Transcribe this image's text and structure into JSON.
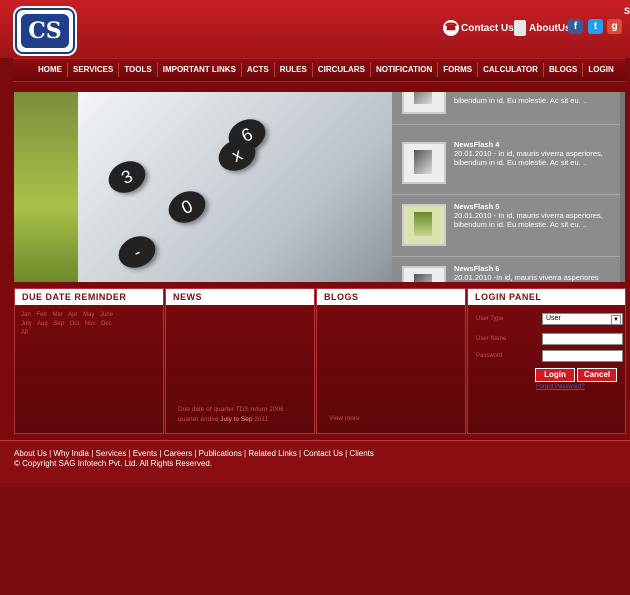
{
  "header": {
    "logo_text": "CS",
    "contact_label": "Contact Us",
    "about_label": "AboutUs",
    "social": [
      {
        "icon": "facebook-icon",
        "letter": "f",
        "color": "#3b5998"
      },
      {
        "icon": "twitter-icon",
        "letter": "t",
        "color": "#1da1f2"
      },
      {
        "icon": "google-icon",
        "letter": "g",
        "color": "#dd4b39"
      }
    ],
    "corner_glyph": "S"
  },
  "nav": [
    "HOME",
    "SERVICES",
    "TOOLS",
    "IMPORTANT LINKS",
    "ACTS",
    "RULES",
    "CIRCULARS",
    "NOTIFICATION",
    "FORMS",
    "CALCULATOR",
    "BLOGS",
    "LOGIN"
  ],
  "banner": {
    "keys": [
      "6",
      "3",
      "x",
      "0",
      "-"
    ]
  },
  "newsflash": [
    {
      "title": "",
      "text": "bibendum in id. Eu molestie. Ac sit eu. .."
    },
    {
      "title": "NewsFlash 4",
      "text": "20.01.2010 - In id, mauris viverra asperiores, bibendum in id. Eu molestie. Ac sit eu. .."
    },
    {
      "title": "NewsFlash 5",
      "text": "20.01.2010 - In id, mauris viverra asperiores, bibendum in id. Eu molestie. Ac sit eu. .."
    },
    {
      "title": "NewsFlash 6",
      "text": "20.01.2010 -In id, mauris viverra asperiores"
    }
  ],
  "panels": {
    "due": {
      "title": "DUE DATE REMINDER",
      "lines": [
        [
          "Jan",
          "Feb",
          "Mar",
          "Apr",
          "May",
          "June"
        ],
        [
          "July",
          "Aug",
          "Sep",
          "Oct",
          "Nov",
          "Dec"
        ],
        [
          "All"
        ]
      ]
    },
    "news": {
      "title": "NEWS",
      "footer": "Due date of quarter TDS return 2006",
      "footer2": "quarter ended",
      "highlight": "July to Sep",
      "tail": "2011"
    },
    "blogs": {
      "title": "BLOGS",
      "footer": "View more"
    },
    "login": {
      "title": "LOGIN PANEL",
      "user_type_label": "User Type",
      "user_type_value": "User",
      "user_name_label": "User Name",
      "password_label": "Password",
      "login_btn": "Login",
      "cancel_btn": "Cancel",
      "forgot": "Forgot Password?"
    }
  },
  "footer": {
    "links": "About Us | Why India | Services | Events | Careers | Publications | Related Links | Contact Us | Clients",
    "copyright": "© Copyright SAG Infotech Pvt. Ltd. All Rights Reserved."
  }
}
